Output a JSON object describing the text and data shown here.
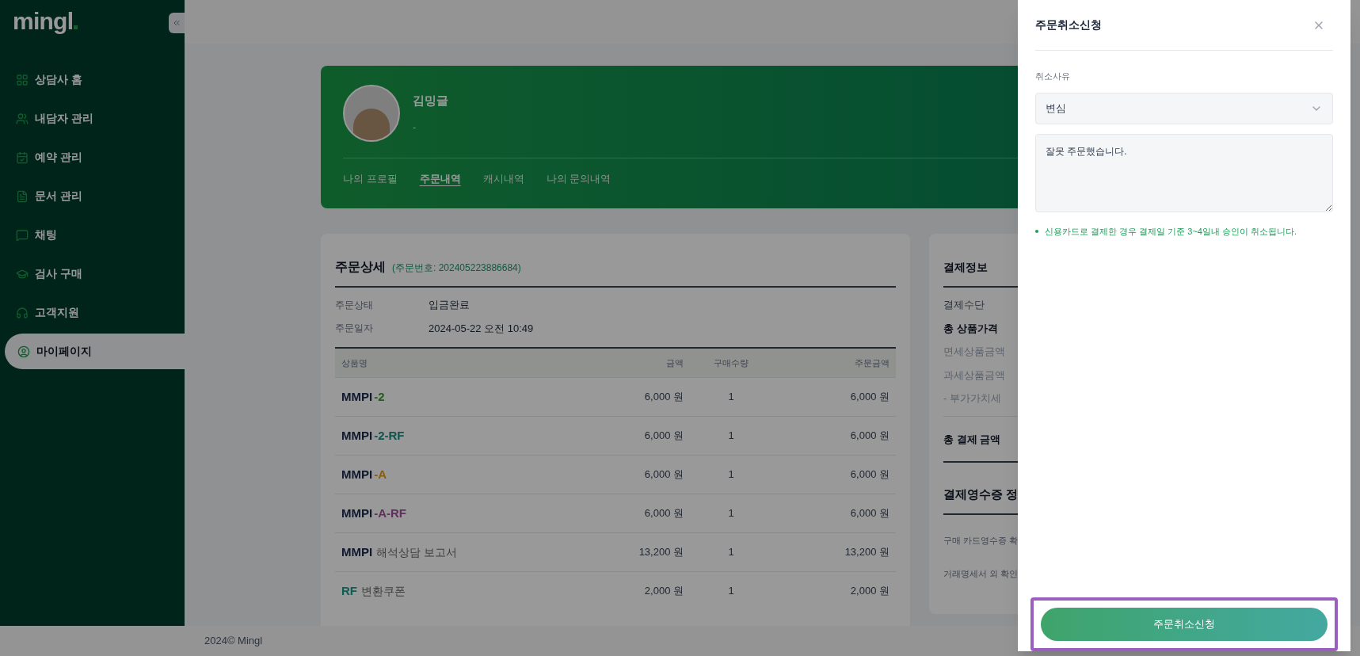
{
  "sidebar": {
    "logo": "mingl",
    "items": [
      {
        "label": "상담사 홈",
        "selected": false
      },
      {
        "label": "내담자 관리",
        "selected": false
      },
      {
        "label": "예약 관리",
        "selected": false
      },
      {
        "label": "문서 관리",
        "selected": false
      },
      {
        "label": "채팅",
        "selected": false
      },
      {
        "label": "검사 구매",
        "selected": false
      },
      {
        "label": "고객지원",
        "selected": false
      },
      {
        "label": "마이페이지",
        "selected": true
      }
    ]
  },
  "profile": {
    "name": "김밍글",
    "subtitle": "-",
    "tabs": [
      {
        "label": "나의 프로필",
        "selected": false
      },
      {
        "label": "주문내역",
        "selected": true
      },
      {
        "label": "캐시내역",
        "selected": false
      },
      {
        "label": "나의 문의내역",
        "selected": false
      }
    ]
  },
  "order_detail": {
    "title": "주문상세",
    "order_number": "(주문번호: 202405223886684)",
    "fields": [
      {
        "label": "주문상태",
        "value": "입금완료"
      },
      {
        "label": "주문일자",
        "value": "2024-05-22 오전 10:49"
      }
    ],
    "table": {
      "columns": [
        "상품명",
        "금액",
        "구매수량",
        "주문금액"
      ],
      "rows": [
        {
          "name": [
            {
              "text": "MMPI",
              "kind": "code",
              "color": "#10192f"
            },
            {
              "text": "-2",
              "kind": "code",
              "color": "#235c23"
            }
          ],
          "price": "6,000 원",
          "quantity": "1",
          "total": "6,000 원"
        },
        {
          "name": [
            {
              "text": "MMPI",
              "kind": "code",
              "color": "#10192f"
            },
            {
              "text": "-2-RF",
              "kind": "code",
              "color": "#10534d"
            }
          ],
          "price": "6,000 원",
          "quantity": "1",
          "total": "6,000 원"
        },
        {
          "name": [
            {
              "text": "MMPI",
              "kind": "code",
              "color": "#10192f"
            },
            {
              "text": "-A",
              "kind": "code",
              "color": "#8a5c0a"
            }
          ],
          "price": "6,000 원",
          "quantity": "1",
          "total": "6,000 원"
        },
        {
          "name": [
            {
              "text": "MMPI",
              "kind": "code",
              "color": "#10192f"
            },
            {
              "text": "-A-RF",
              "kind": "code",
              "color": "#60305c"
            }
          ],
          "price": "6,000 원",
          "quantity": "1",
          "total": "6,000 원"
        },
        {
          "name": [
            {
              "text": "MMPI",
              "kind": "code",
              "color": "#10192f"
            },
            {
              "text": "해석상담 보고서",
              "kind": "label",
              "color": "#3d3d3d"
            }
          ],
          "price": "13,200 원",
          "quantity": "1",
          "total": "13,200 원"
        },
        {
          "name": [
            {
              "text": "RF",
              "kind": "code",
              "color": "#105c53"
            },
            {
              "text": "변환쿠폰",
              "kind": "label",
              "color": "#3d3d3d"
            }
          ],
          "price": "2,000 원",
          "quantity": "1",
          "total": "2,000 원"
        }
      ]
    }
  },
  "payment_info": {
    "title": "결제정보",
    "rows": [
      {
        "label": "결제수단",
        "kind": "item"
      },
      {
        "label": "총 상품가격",
        "kind": "total"
      },
      {
        "label": "면세상품금액",
        "kind": "sub"
      },
      {
        "label": "과세상품금액",
        "kind": "sub"
      },
      {
        "label": "- 부가가치세",
        "kind": "sub"
      }
    ],
    "grand_total": "총 결제 금액",
    "receipt": {
      "title": "결제영수증 정",
      "rows": [
        "구매 카드영수증 확",
        "거래명세서 외 확인"
      ]
    }
  },
  "footer": "2024© Mingl",
  "cancel_drawer": {
    "title": "주문취소신청",
    "reason_label": "취소사유",
    "reason": "변심",
    "message": "잘못 주문했습니다.",
    "note": "신용카드로 결제한 경우 결제일 기준 3~4일내 승인이 취소됩니다.",
    "submit": "주문취소신청"
  }
}
